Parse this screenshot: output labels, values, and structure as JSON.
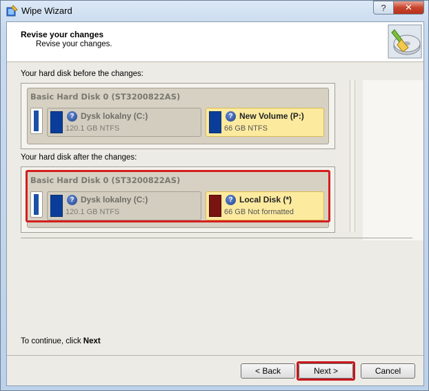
{
  "window": {
    "title": "Wipe Wizard",
    "help_label": "?",
    "close_label": "✕"
  },
  "header": {
    "title": "Revise your changes",
    "subtitle": "Revise your changes."
  },
  "before": {
    "label": "Your hard disk before the changes:",
    "disk_title": "Basic Hard Disk 0 (ST3200822AS)",
    "partitions": [
      {
        "name": "Dysk lokalny (C:)",
        "info": "120.1 GB NTFS",
        "color": "#0a3d9a"
      },
      {
        "name": "New Volume (P:)",
        "info": "66 GB NTFS",
        "color": "#0a3d9a"
      }
    ]
  },
  "after": {
    "label": "Your hard disk after the changes:",
    "disk_title": "Basic Hard Disk 0 (ST3200822AS)",
    "partitions": [
      {
        "name": "Dysk lokalny (C:)",
        "info": "120.1 GB NTFS",
        "color": "#0a3d9a"
      },
      {
        "name": "Local Disk (*)",
        "info": "66 GB Not formatted",
        "color": "#7a1410"
      }
    ]
  },
  "footer": {
    "continue_prefix": "To continue, click ",
    "continue_bold": "Next",
    "back_label": "< Back",
    "next_label": "Next >",
    "cancel_label": "Cancel"
  },
  "colors": {
    "highlight": "#d51d1d",
    "selected_partition": "#fcea9f"
  }
}
